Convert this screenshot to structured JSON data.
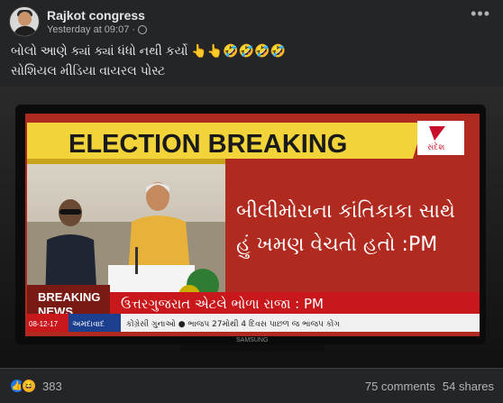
{
  "post": {
    "page_name": "Rajkot congress",
    "timestamp": "Yesterday at 09:07",
    "caption_line1": "બોલો આણે ક્યાં ક્યાં ધંધો નથી કર્યો 👆👆🤣🤣🤣🤣",
    "caption_line2": "સોશિયલ મીડિયા વાયરલ પોસ્ટ",
    "more_label": "•••"
  },
  "tv": {
    "headline": "ELECTION BREAKING",
    "channel_logo_text": "સંદેશ",
    "red_panel_line1": "બીલીમોરાના કાંતિકાકા સાથે",
    "red_panel_line2": "હું ખમણ વેચતો હતો :PM",
    "breaking_line1": "BREAKING",
    "breaking_line2": "NEWS",
    "ticker_main": "ઉત્તરગુજરાત એટલે ભોળા રાજા : PM",
    "date_tag": "08-12-17",
    "city_tag": "અમદાવાદ",
    "ticker_small": "કોંગ્રેસી ગુનાઓ ● ભાજપ 27મોથી 4 દિવસ પાછળ જ ભાજપ કોંગ",
    "brand": "SAMSUNG"
  },
  "footer": {
    "reaction_count": "383",
    "comments": "75 comments",
    "shares": "54 shares"
  }
}
